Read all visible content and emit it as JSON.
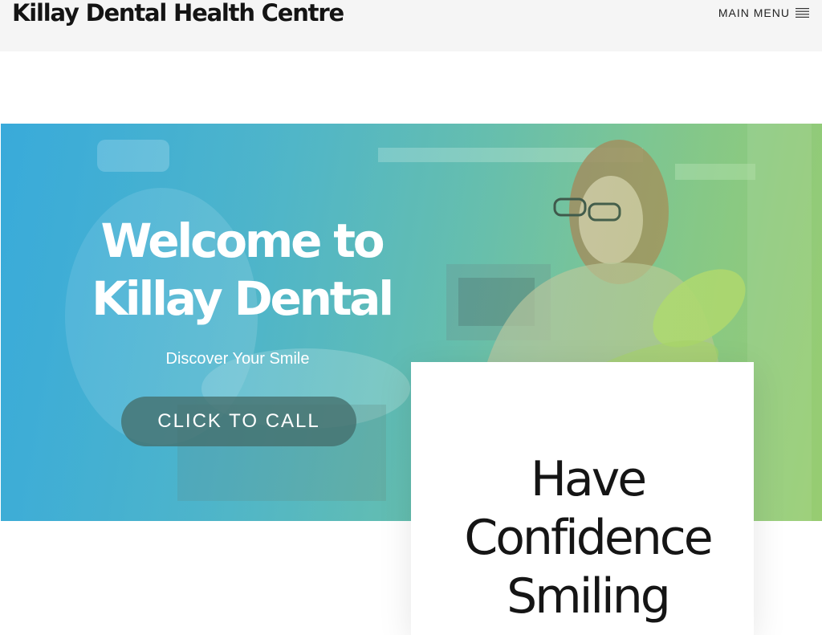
{
  "header": {
    "site_title": "Killay Dental Health Centre",
    "menu_label": "MAIN MENU",
    "menu_icon": "hamburger-icon"
  },
  "hero": {
    "heading": "Welcome to Killay Dental",
    "subheading": "Discover Your Smile",
    "cta_label": "CLICK TO CALL"
  },
  "card": {
    "heading": "Have Confidence Smiling"
  },
  "colors": {
    "gradient_start": "#38a9da",
    "gradient_end": "#a3d169",
    "cta_background": "#446e6c",
    "title_text": "#141414"
  }
}
